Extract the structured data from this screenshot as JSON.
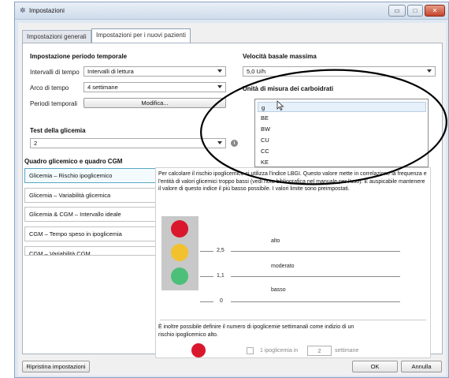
{
  "window": {
    "title": "Impostazioni",
    "title_icon": "gear-icon",
    "controls": {
      "minimize": "▭",
      "maximize": "□",
      "close": "✕"
    }
  },
  "tabs": [
    {
      "label": "Impostazioni generali",
      "active": false
    },
    {
      "label": "Impostazioni per i nuovi pazienti",
      "active": true
    }
  ],
  "period": {
    "title": "Impostazione periodo temporale",
    "interval_label": "Intervalli di tempo",
    "interval_value": "Intervalli di lettura",
    "arc_label": "Arco di tempo",
    "arc_value": "4 settimane",
    "periods_label": "Periodi temporali",
    "modify_button": "Modifica..."
  },
  "test": {
    "title": "Test della glicemia",
    "value": "2"
  },
  "basal": {
    "title": "Velocità basale massima",
    "value": "5,0 U/h"
  },
  "carbs": {
    "title": "Unità di misura dei carboidrati",
    "options": [
      "g",
      "BE",
      "BW",
      "CU",
      "CC",
      "KE"
    ],
    "highlighted": "g"
  },
  "glycemic": {
    "title": "Quadro glicemico e quadro CGM",
    "items": [
      "Glicemia – Rischio ipoglicemico",
      "Glicemia – Variabilità glicemica",
      "Glicemia & CGM – Intervallo ideale",
      "CGM – Tempo speso in ipoglicemia",
      "CGM – Variabilità CGM"
    ],
    "active_index": 0
  },
  "tooltip": {
    "text": "Per calcolare il rischio ipoglicemico si utilizza l'indice LBGI. Questo valore mette in correlazione la frequenza e l'entità di valori glicemici troppo bassi (vedi nota bibliografica nel manuale per l'uso). È auspicabile mantenere il valore di questo indice il più basso possibile. I valori limite sono preimpostati.",
    "levels": [
      "alto",
      "moderato",
      "basso"
    ],
    "thresholds": [
      "2,5",
      "1,1",
      "0"
    ],
    "lamp_colors": {
      "red": "#d9182d",
      "yellow": "#f2c12e",
      "green": "#4cbf78"
    },
    "extra_text": "È inoltre possibile definire il numero di ipoglicemie settimanali come indizio di un rischio ipoglicemico alto.",
    "checkbox_label": "1 ipoglicemia in",
    "weeks_value": "2",
    "weeks_label": "settimane"
  },
  "footer": {
    "reset_button": "Ripristina impostazioni",
    "ok_button": "OK",
    "cancel_button": "Annulla"
  }
}
